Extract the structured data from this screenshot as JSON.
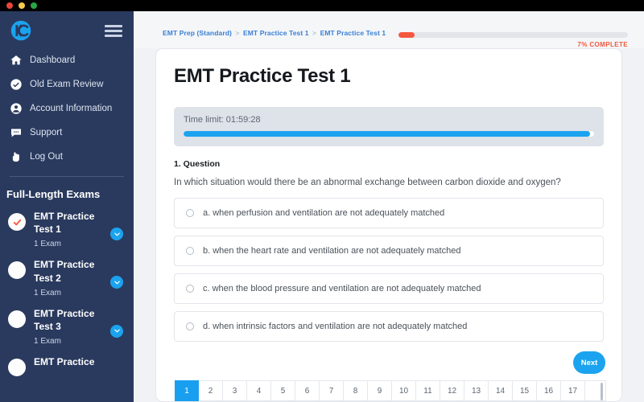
{
  "titlebar": {
    "dots": [
      "red",
      "yellow",
      "green"
    ]
  },
  "sidebar": {
    "logo_name": "ec-logo",
    "menu_icon": "hamburger-menu-icon",
    "nav": [
      {
        "label": "Dashboard",
        "icon": "home-icon"
      },
      {
        "label": "Old Exam Review",
        "icon": "check-circle-icon"
      },
      {
        "label": "Account Information",
        "icon": "user-circle-icon"
      },
      {
        "label": "Support",
        "icon": "chat-bubble-icon"
      },
      {
        "label": "Log Out",
        "icon": "hand-pointer-icon"
      }
    ],
    "section_title": "Full-Length Exams",
    "exams": [
      {
        "name": "EMT Practice Test 1",
        "count": "1 Exam",
        "state": "completed"
      },
      {
        "name": "EMT Practice Test 2",
        "count": "1 Exam",
        "state": "empty"
      },
      {
        "name": "EMT Practice Test 3",
        "count": "1 Exam",
        "state": "empty"
      },
      {
        "name": "EMT Practice",
        "count": "",
        "state": "empty"
      }
    ]
  },
  "topbar": {
    "breadcrumb": [
      "EMT Prep (Standard)",
      "EMT Practice Test 1",
      "EMT Practice Test 1"
    ],
    "breadcrumb_separator": ">",
    "progress_label": "7% COMPLETE",
    "progress_percent": 7,
    "progress_color": "#f4573e"
  },
  "card": {
    "title": "EMT Practice Test 1",
    "timer_label": "Time limit: 01:59:28",
    "timer_percent": 99,
    "timer_color": "#1ba3ef",
    "question_number": "1. Question",
    "question_text": "In which situation would there be an abnormal exchange between carbon dioxide and oxygen?",
    "options": [
      {
        "label": "a. when perfusion and ventilation are not adequately matched",
        "selected": false
      },
      {
        "label": "b. when the heart rate and ventilation are not adequately matched",
        "selected": false
      },
      {
        "label": "c. when the blood pressure and ventilation are not adequately matched",
        "selected": false
      },
      {
        "label": "d. when intrinsic factors and ventilation are not adequately matched",
        "selected": false
      }
    ],
    "next_label": "Next",
    "pagination": {
      "pages": [
        "1",
        "2",
        "3",
        "4",
        "5",
        "6",
        "7",
        "8",
        "9",
        "10",
        "11",
        "12",
        "13",
        "14",
        "15",
        "16",
        "17"
      ],
      "active": "1"
    }
  }
}
